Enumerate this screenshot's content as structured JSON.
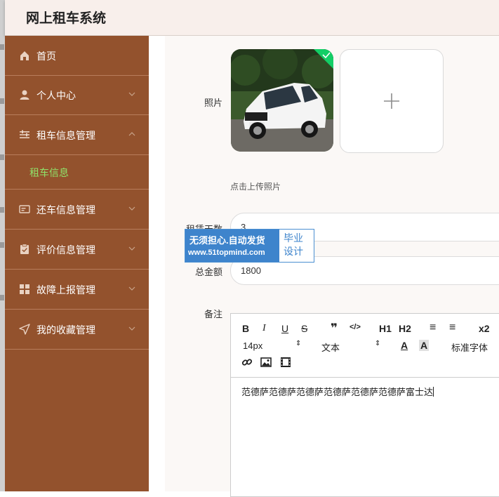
{
  "header": {
    "title": "网上租车系统"
  },
  "sidebar": {
    "items": [
      {
        "label": "首页"
      },
      {
        "label": "个人中心"
      },
      {
        "label": "租车信息管理"
      },
      {
        "label": "还车信息管理"
      },
      {
        "label": "评价信息管理"
      },
      {
        "label": "故障上报管理"
      },
      {
        "label": "我的收藏管理"
      }
    ],
    "submenu": {
      "label": "租车信息"
    }
  },
  "form": {
    "photo": {
      "label": "照片",
      "upload_hint": "点击上传照片"
    },
    "rent_days": {
      "label": "租赁天数",
      "value": "3"
    },
    "total": {
      "label": "总金额",
      "value": "1800"
    },
    "remark": {
      "label": "备注",
      "content": "范德萨范德萨范德萨范德萨范德萨范德萨富士达",
      "toolbar": {
        "bold": "B",
        "italic": "I",
        "underline": "U",
        "strike": "S",
        "quote": "❞",
        "code": "</>",
        "h1": "H1",
        "h2": "H2",
        "ordered_list": "≡",
        "bullet_list": "≡",
        "subscript": "x2",
        "font_size": "14px",
        "paragraph": "文本",
        "font_color": "A",
        "background": "A",
        "font_family": "标准字体"
      }
    }
  },
  "watermark": {
    "line1": "无须担心.自动发货",
    "line2": "www.51topmind.com",
    "right1": "毕业",
    "right2": "设计"
  }
}
